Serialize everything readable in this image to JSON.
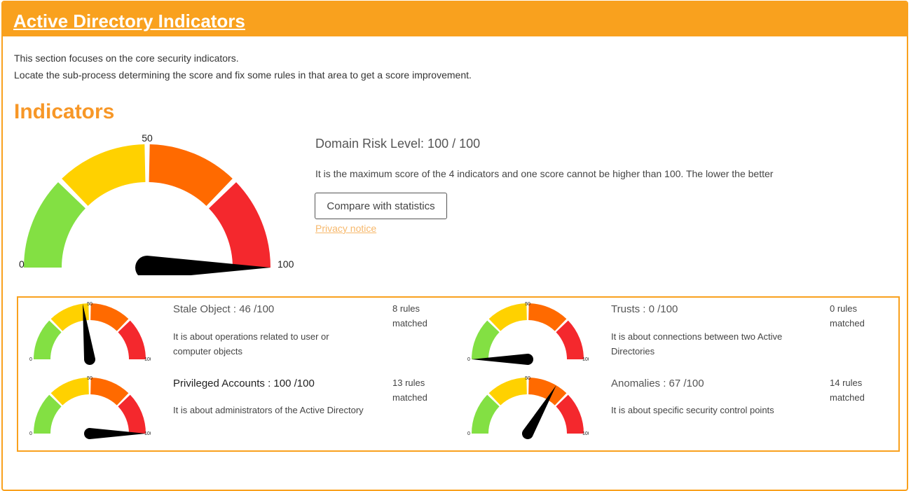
{
  "header": {
    "title": "Active Directory Indicators"
  },
  "intro": {
    "line1": "This section focuses on the core security indicators.",
    "line2": "Locate the sub-process determining the score and fix some rules in that area to get a score improvement."
  },
  "indicators": {
    "heading": "Indicators",
    "gauge": {
      "min_label": "0",
      "mid_label": "50",
      "max_label": "100",
      "value": 100
    },
    "risk_title": "Domain Risk Level: 100 / 100",
    "risk_desc": "It is the maximum score of the 4 indicators and one score cannot be higher than 100. The lower the better",
    "compare_label": "Compare with statistics",
    "privacy_label": "Privacy notice"
  },
  "sub_indicators": [
    {
      "title": "Stale Object : 46 /100",
      "value": 46,
      "desc": "It is about operations related to user or computer objects",
      "rules": "8 rules matched"
    },
    {
      "title": "Trusts : 0 /100",
      "value": 0,
      "desc": "It is about connections between two Active Directories",
      "rules": "0 rules matched"
    },
    {
      "title": "Privileged Accounts : 100 /100",
      "value": 100,
      "desc": "It is about administrators of the Active Directory",
      "rules": "13 rules matched"
    },
    {
      "title": "Anomalies : 67 /100",
      "value": 67,
      "desc": "It is about specific security control points",
      "rules": "14 rules matched"
    }
  ],
  "colors": {
    "accent": "#f9a11e",
    "green": "#83e043",
    "yellow": "#ffd100",
    "orange": "#ff6a00",
    "red": "#f4282d"
  }
}
